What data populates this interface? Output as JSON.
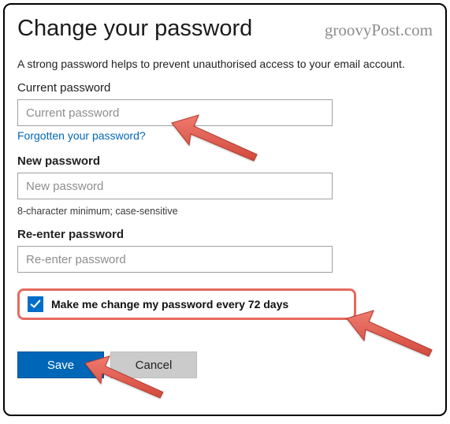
{
  "header": {
    "title": "Change your password",
    "watermark": "groovyPost.com"
  },
  "subtitle": "A strong password helps to prevent unauthorised access to your email account.",
  "fields": {
    "current": {
      "label": "Current password",
      "placeholder": "Current password",
      "forgot_link": "Forgotten your password?"
    },
    "new": {
      "label": "New password",
      "placeholder": "New password",
      "hint": "8-character minimum; case-sensitive"
    },
    "reenter": {
      "label": "Re-enter password",
      "placeholder": "Re-enter password"
    }
  },
  "checkbox": {
    "checked": true,
    "label": "Make me change my password every 72 days"
  },
  "buttons": {
    "save": "Save",
    "cancel": "Cancel"
  }
}
